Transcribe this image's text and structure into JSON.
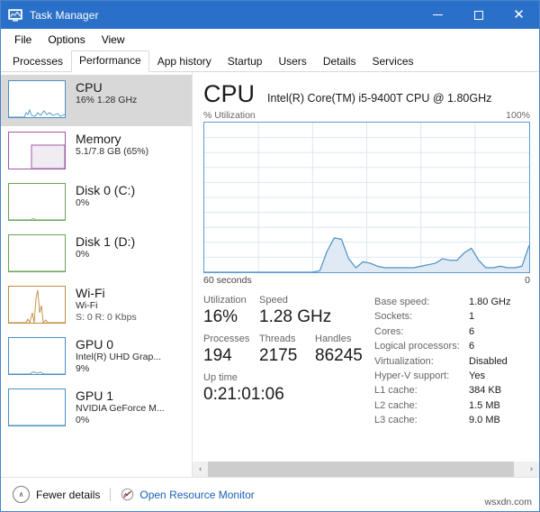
{
  "window": {
    "title": "Task Manager",
    "icon": "task-manager-icon",
    "buttons": {
      "minimize": "–",
      "maximize": "□",
      "close": "✕"
    },
    "titlebar_color": "#2b70c8"
  },
  "menubar": {
    "items": [
      "File",
      "Options",
      "View"
    ]
  },
  "tabs": {
    "items": [
      {
        "label": "Processes",
        "active": false
      },
      {
        "label": "Performance",
        "active": true
      },
      {
        "label": "App history",
        "active": false
      },
      {
        "label": "Startup",
        "active": false
      },
      {
        "label": "Users",
        "active": false
      },
      {
        "label": "Details",
        "active": false
      },
      {
        "label": "Services",
        "active": false
      }
    ]
  },
  "sidebar": {
    "items": [
      {
        "name": "cpu",
        "title": "CPU",
        "sub1": "16%  1.28 GHz",
        "sub2": "",
        "selected": true,
        "color": "#4a90c4",
        "thumb": "line"
      },
      {
        "name": "memory",
        "title": "Memory",
        "sub1": "5.1/7.8 GB (65%)",
        "sub2": "",
        "selected": false,
        "color": "#a05aa8",
        "thumb": "composition"
      },
      {
        "name": "disk0",
        "title": "Disk 0 (C:)",
        "sub1": "0%",
        "sub2": "",
        "selected": false,
        "color": "#68a357",
        "thumb": "flat"
      },
      {
        "name": "disk1",
        "title": "Disk 1 (D:)",
        "sub1": "0%",
        "sub2": "",
        "selected": false,
        "color": "#68a357",
        "thumb": "flat"
      },
      {
        "name": "wifi",
        "title": "Wi-Fi",
        "sub1": "Wi-Fi",
        "sub2": "S: 0 R: 0 Kbps",
        "selected": false,
        "color": "#c08a3e",
        "thumb": "spikes"
      },
      {
        "name": "gpu0",
        "title": "GPU 0",
        "sub1": "Intel(R) UHD Grap...",
        "sub2": "9%",
        "selected": false,
        "color": "#4a90c4",
        "thumb": "lowline"
      },
      {
        "name": "gpu1",
        "title": "GPU 1",
        "sub1": "NVIDIA GeForce M...",
        "sub2": "0%",
        "selected": false,
        "color": "#4a90c4",
        "thumb": "flat"
      }
    ]
  },
  "main": {
    "heading": "CPU",
    "model": "Intel(R) Core(TM) i5-9400T CPU @ 1.80GHz",
    "graph_label_left": "% Utilization",
    "graph_label_right": "100%",
    "graph_foot_left": "60 seconds",
    "graph_foot_right": "0",
    "stats": {
      "utilization_label": "Utilization",
      "utilization_value": "16%",
      "speed_label": "Speed",
      "speed_value": "1.28 GHz",
      "processes_label": "Processes",
      "processes_value": "194",
      "threads_label": "Threads",
      "threads_value": "2175",
      "handles_label": "Handles",
      "handles_value": "86245",
      "uptime_label": "Up time",
      "uptime_value": "0:21:01:06"
    },
    "specs": [
      {
        "key": "Base speed:",
        "value": "1.80 GHz"
      },
      {
        "key": "Sockets:",
        "value": "1"
      },
      {
        "key": "Cores:",
        "value": "6"
      },
      {
        "key": "Logical processors:",
        "value": "6"
      },
      {
        "key": "Virtualization:",
        "value": "Disabled"
      },
      {
        "key": "Hyper-V support:",
        "value": "Yes"
      },
      {
        "key": "L1 cache:",
        "value": "384 KB"
      },
      {
        "key": "L2 cache:",
        "value": "1.5 MB"
      },
      {
        "key": "L3 cache:",
        "value": "9.0 MB"
      }
    ]
  },
  "scrollbar": {
    "left_arrow": "‹",
    "right_arrow": "›"
  },
  "statusbar": {
    "fewer_details": "Fewer details",
    "fewer_chevron": "∧",
    "resource_monitor": "Open Resource Monitor",
    "link_color": "#1a5fb4"
  },
  "watermark": "wsxdn.com",
  "chart_data": {
    "type": "area",
    "title": "% Utilization",
    "xlabel": "60 seconds",
    "ylabel": "% Utilization",
    "ylim": [
      0,
      100
    ],
    "xlim": [
      60,
      0
    ],
    "grid": true,
    "grid_rows": 10,
    "grid_cols": 6,
    "line_color": "#4a90c4",
    "fill_color": "#dfeaf4",
    "x": [
      60,
      58,
      56,
      54,
      52,
      50,
      48,
      46,
      44,
      42,
      40,
      38,
      36,
      34,
      32,
      30,
      29,
      28,
      27,
      26,
      25,
      24,
      23,
      22,
      21,
      20,
      19,
      18,
      17,
      16,
      15,
      14,
      13,
      12,
      11,
      10,
      9,
      8,
      7,
      6,
      5,
      4,
      3,
      2,
      1,
      0
    ],
    "values": [
      0,
      0,
      0,
      0,
      0,
      0,
      0,
      0,
      0,
      0,
      0,
      0,
      0,
      0,
      0,
      0,
      1,
      14,
      23,
      22,
      9,
      3,
      7,
      6,
      4,
      3,
      3,
      3,
      3,
      3,
      4,
      5,
      6,
      9,
      8,
      8,
      13,
      16,
      8,
      3,
      3,
      4,
      3,
      3,
      4,
      18
    ]
  }
}
